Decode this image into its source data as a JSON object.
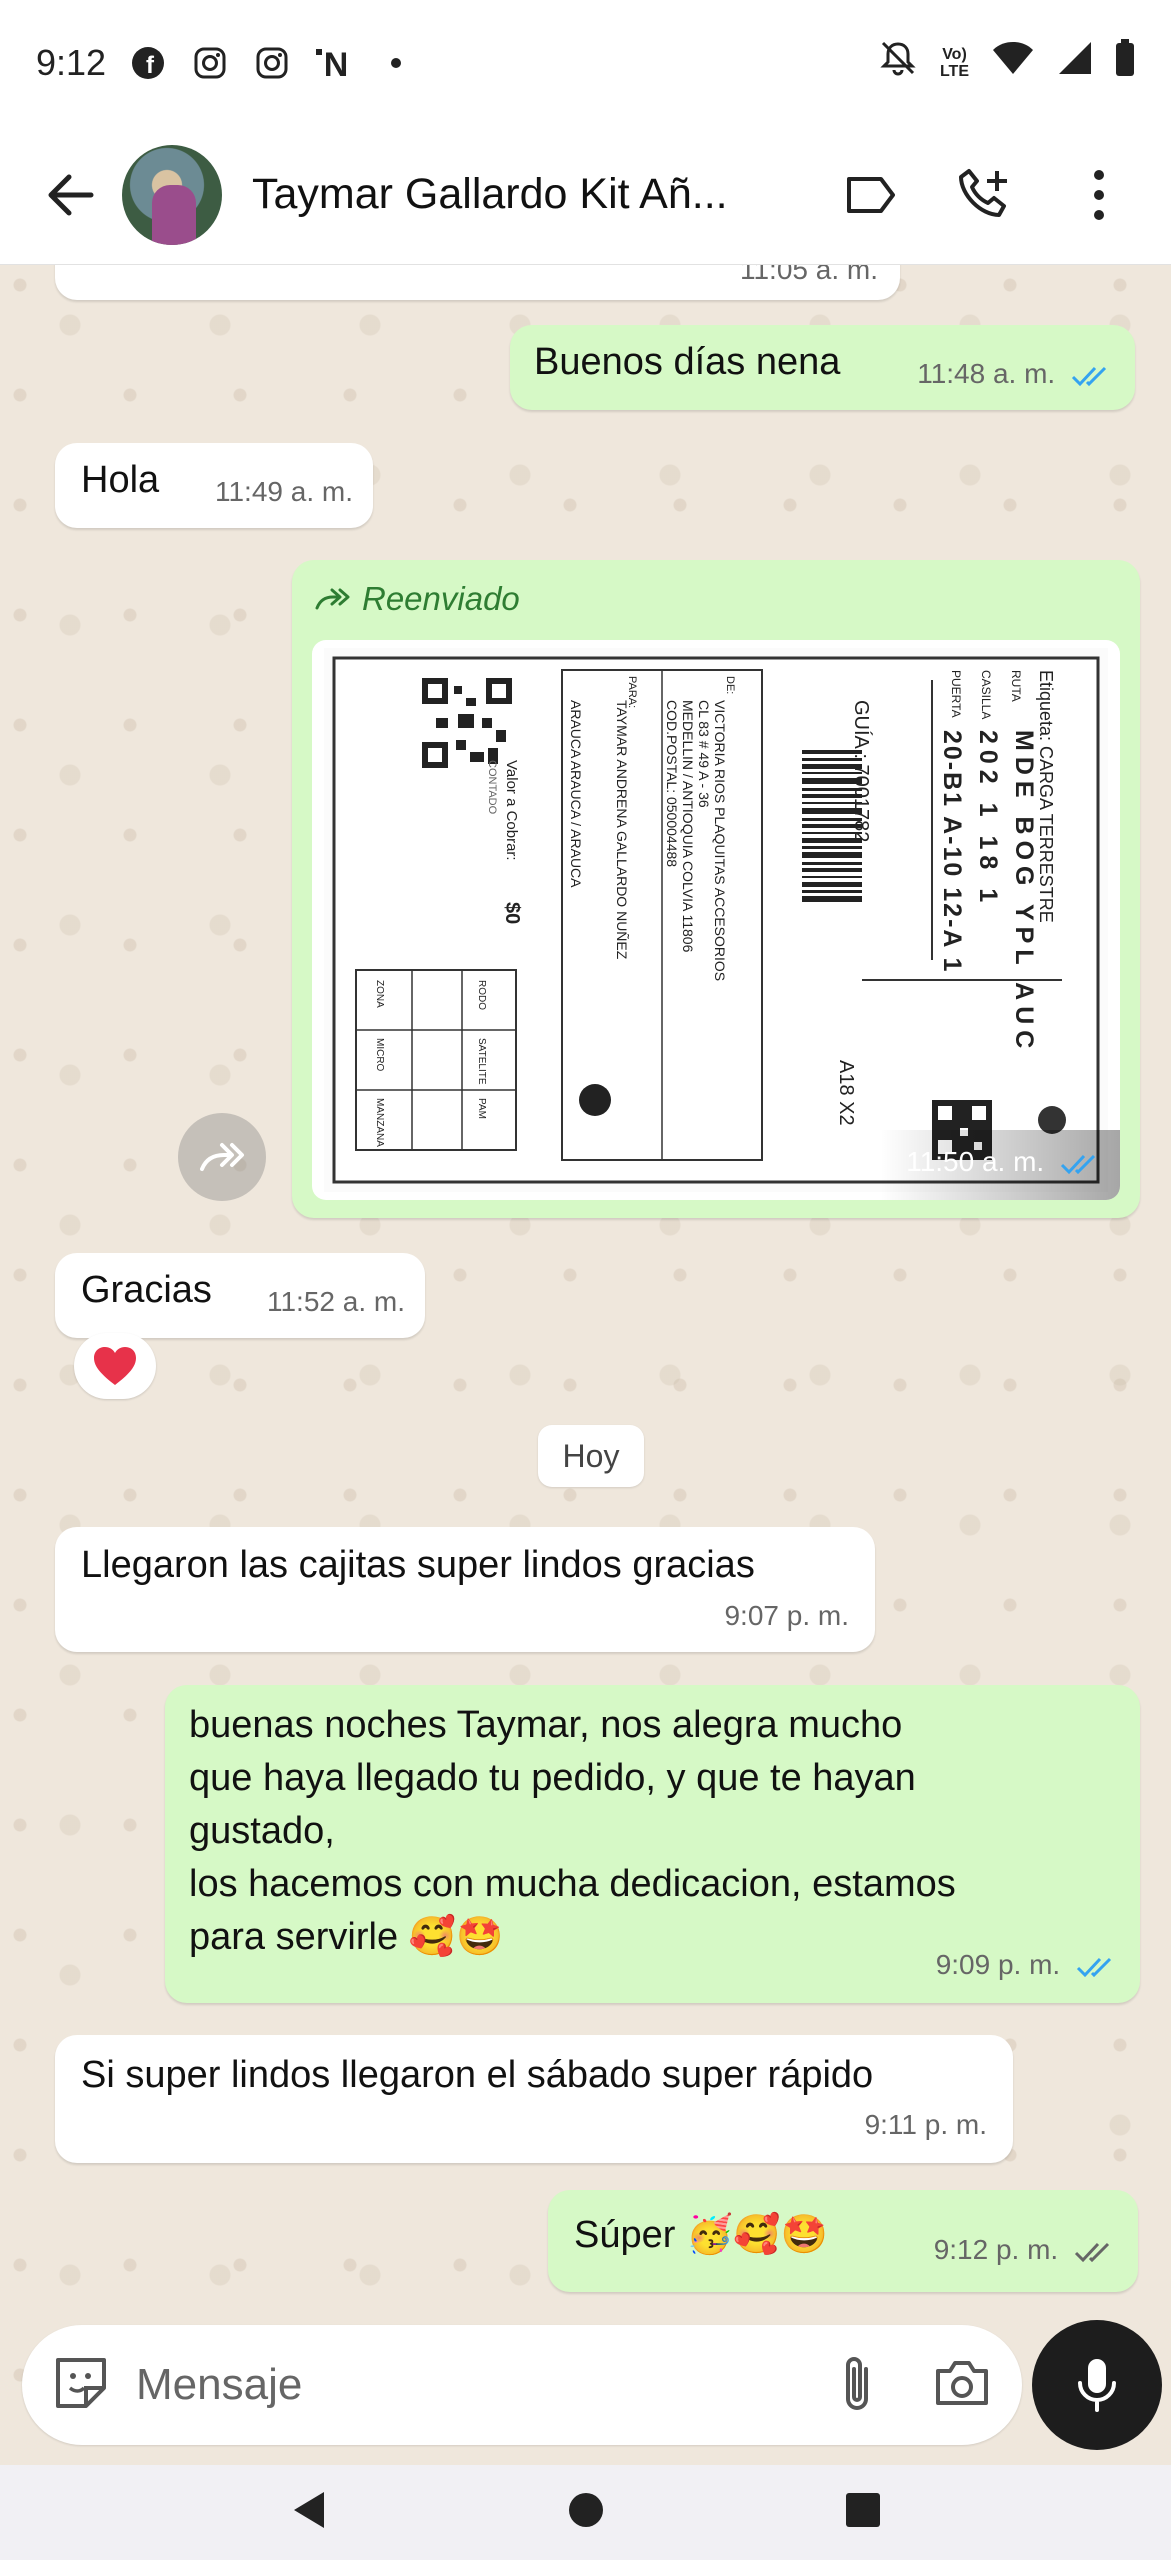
{
  "status_bar": {
    "time": "9:12",
    "notification_icons": [
      "facebook-icon",
      "instagram-icon",
      "instagram-icon",
      "n-app-icon",
      "dot-icon"
    ],
    "right_icons": [
      "mute-icon",
      "volte-icon",
      "wifi-icon",
      "signal-icon",
      "battery-icon"
    ],
    "volte_label_top": "Vo)",
    "volte_label_bottom": "LTE"
  },
  "header": {
    "contact_name": "Taymar Gallardo Kit Añ...",
    "icons": [
      "back-arrow-icon",
      "label-icon",
      "add-call-icon",
      "more-vert-icon"
    ]
  },
  "messages": [
    {
      "id": "m0",
      "direction": "in",
      "time": "11:05 a. m."
    },
    {
      "id": "m1",
      "direction": "out",
      "text": "Buenos días nena",
      "time": "11:48 a. m.",
      "status": "read"
    },
    {
      "id": "m2",
      "direction": "in",
      "text": "Hola",
      "time": "11:49 a. m."
    },
    {
      "id": "m3",
      "direction": "out",
      "type": "image",
      "forwarded_label": "Reenviado",
      "time": "11:50 a. m.",
      "status": "read"
    },
    {
      "id": "m4",
      "direction": "in",
      "text": "Gracias",
      "time": "11:52 a. m.",
      "reaction": "❤️"
    },
    {
      "id": "m5",
      "direction": "in",
      "text": "Llegaron las cajitas super lindos gracias",
      "time": "9:07 p. m."
    },
    {
      "id": "m6",
      "direction": "out",
      "lines": [
        "buenas noches Taymar, nos alegra mucho",
        "que haya llegado tu pedido, y que te hayan",
        "gustado,",
        "los hacemos con mucha dedicacion, estamos"
      ],
      "last_line": "para servirle 🥰🤩",
      "time": "9:09 p. m.",
      "status": "read"
    },
    {
      "id": "m7",
      "direction": "in",
      "text": "Si super lindos llegaron el sábado super rápido",
      "time": "9:11 p. m."
    },
    {
      "id": "m8",
      "direction": "out",
      "text": "Súper 🥳🥰🤩",
      "time": "9:12 p. m.",
      "status": "delivered"
    }
  ],
  "date_chip": "Hoy",
  "shipping_label": {
    "etiqueta": "Etiqueta: CARGA TERRESTRE",
    "route_header": "RUTA",
    "route": [
      "MDE",
      "BOG",
      "YPL",
      "AUC"
    ],
    "casilla_header": "CASILLA",
    "casilla": [
      "202",
      "1",
      "18",
      "1"
    ],
    "puerta_header": "PUERTA",
    "puerta": [
      "20-B1",
      "A-10",
      "12-A",
      "1"
    ],
    "guia": "GUÍA : 7001782",
    "code": "A18 X2",
    "de_label": "DE:",
    "de_lines": [
      "VICTORIA RIOS PLAQUITAS ACCESORIOS",
      "CL 83 # 49 A - 36",
      "MEDELLIN / ANTIOQUIA COLVIA 11806",
      "COD.POSTAL: 050004488"
    ],
    "para_label": "PARA:",
    "para_lines": [
      "TAYMAR ANDRENA GALLARDO NUÑEZ",
      "ARAUCA ARAUCA / ARAUCA"
    ],
    "valor_label": "Valor a Cobrar:",
    "valor": "$0",
    "contado": "CONTADO",
    "table_headers": [
      "RODO",
      "SATELITE",
      "PAM"
    ],
    "table_labels": [
      "ZONA",
      "MICRO",
      "MANZANA"
    ]
  },
  "composer": {
    "placeholder": "Mensaje",
    "icons": [
      "sticker-icon",
      "attach-icon",
      "camera-icon",
      "mic-icon"
    ]
  },
  "nav_bar": {
    "icons": [
      "back-triangle-icon",
      "home-circle-icon",
      "recents-square-icon"
    ]
  },
  "colors": {
    "outgoing_bubble": "#d6f9c6",
    "incoming_bubble": "#ffffff",
    "chat_background": "#efe7dc",
    "read_ticks": "#34a3f0",
    "delivered_ticks": "#666666",
    "forwarded_text": "#2e7d32"
  }
}
